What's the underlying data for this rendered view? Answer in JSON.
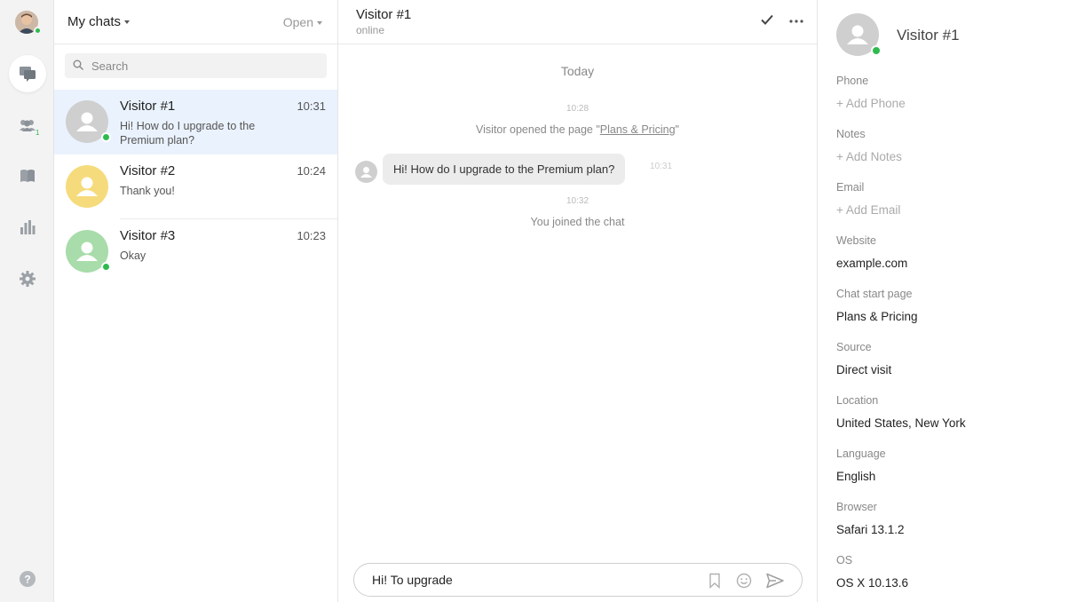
{
  "nav": {
    "items": [
      "chats-icon",
      "visitors-icon",
      "archive-icon",
      "reports-icon",
      "settings-icon"
    ],
    "visitors_badge": "1",
    "help_icon": "help-icon"
  },
  "chat_list": {
    "title": "My chats",
    "filter": "Open",
    "search_placeholder": "Search",
    "chats": [
      {
        "name": "Visitor #1",
        "time": "10:31",
        "preview": "Hi! How do I upgrade to the Premium plan?",
        "avatar_color": "#cfcfcf",
        "online": true
      },
      {
        "name": "Visitor #2",
        "time": "10:24",
        "preview": "Thank you!",
        "avatar_color": "#f6db7d",
        "online": false
      },
      {
        "name": "Visitor #3",
        "time": "10:23",
        "preview": "Okay",
        "avatar_color": "#a8dcaa",
        "online": true
      }
    ]
  },
  "conversation": {
    "name": "Visitor #1",
    "status": "online",
    "day_label": "Today",
    "ts1": "10:28",
    "sys1_prefix": "Visitor opened the page \"",
    "sys1_link": "Plans & Pricing",
    "sys1_suffix": "\"",
    "message": "Hi! How do I upgrade to the Premium plan?",
    "message_time": "10:31",
    "ts2": "10:32",
    "sys2": "You joined the chat",
    "composer_value": "Hi! To upgrade"
  },
  "details": {
    "name": "Visitor #1",
    "fields": [
      {
        "label": "Phone",
        "value": "+ Add Phone",
        "add": true
      },
      {
        "label": "Notes",
        "value": "+ Add Notes",
        "add": true
      },
      {
        "label": "Email",
        "value": "+ Add Email",
        "add": true
      },
      {
        "label": "Website",
        "value": "example.com",
        "add": false
      },
      {
        "label": "Chat start page",
        "value": "Plans & Pricing",
        "add": false
      },
      {
        "label": "Source",
        "value": "Direct visit",
        "add": false
      },
      {
        "label": "Location",
        "value": "United States, New York",
        "add": false
      },
      {
        "label": "Language",
        "value": "English",
        "add": false
      },
      {
        "label": "Browser",
        "value": "Safari 13.1.2",
        "add": false
      },
      {
        "label": "OS",
        "value": "OS X 10.13.6",
        "add": false
      }
    ]
  },
  "colors": {
    "online": "#2dbb4e",
    "active_row": "#eaf2fd",
    "icon_gray": "#9aa0a6"
  }
}
